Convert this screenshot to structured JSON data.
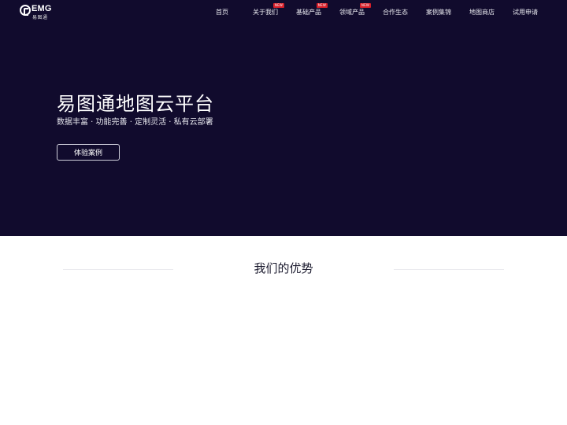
{
  "brand": {
    "logo_text": "EMG",
    "logo_sub": "易图通"
  },
  "nav": {
    "items": [
      {
        "label": "首页",
        "badge": ""
      },
      {
        "label": "关于我们",
        "badge": "NEW"
      },
      {
        "label": "基础产品",
        "badge": "NEW"
      },
      {
        "label": "领域产品",
        "badge": "NEW"
      },
      {
        "label": "合作生态",
        "badge": ""
      },
      {
        "label": "案例集锦",
        "badge": ""
      },
      {
        "label": "地图商店",
        "badge": ""
      },
      {
        "label": "试用申请",
        "badge": ""
      }
    ]
  },
  "hero": {
    "title": "易图通地图云平台",
    "subtitle": "数据丰富 · 功能完善 · 定制灵活 · 私有云部署",
    "cta_label": "体验案例"
  },
  "advantages": {
    "title": "我们的优势"
  },
  "colors": {
    "hero_bg": "#110b2d",
    "badge": "#d61f2a"
  }
}
